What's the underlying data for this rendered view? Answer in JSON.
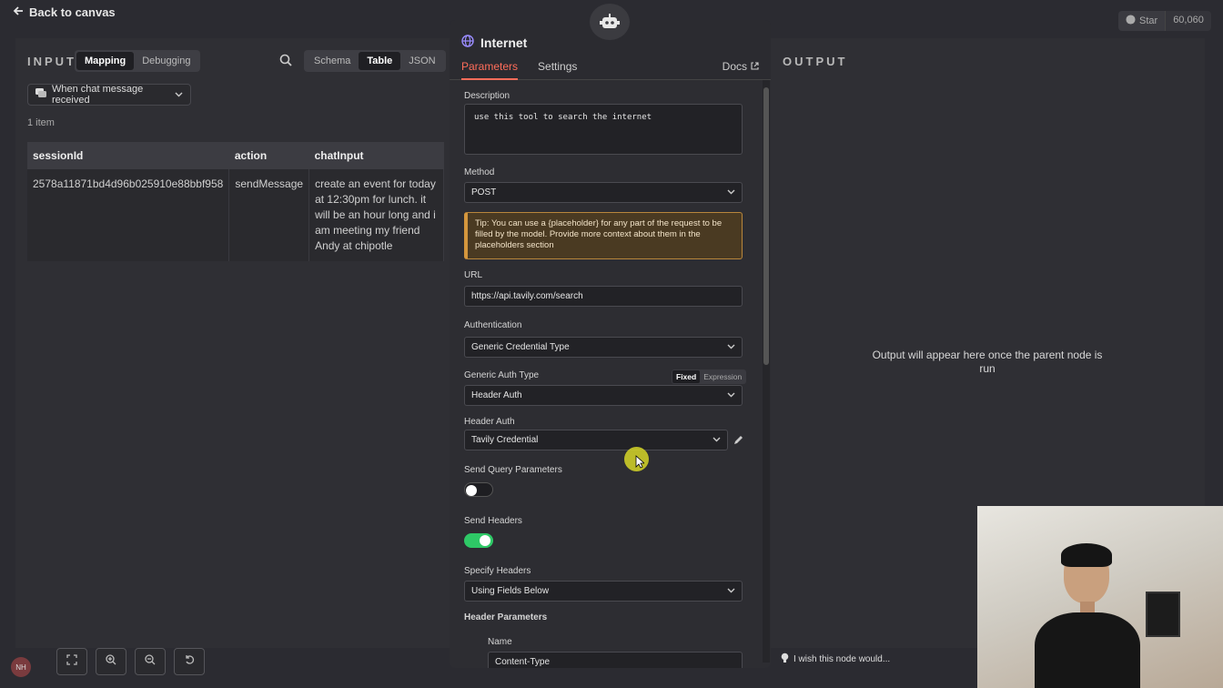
{
  "canvas": {
    "back_label": "Back to canvas",
    "star_label": "Star",
    "star_count": "60,060"
  },
  "input": {
    "title": "INPUT",
    "mode_tabs": [
      "Mapping",
      "Debugging"
    ],
    "view_tabs": [
      "Schema",
      "Table",
      "JSON"
    ],
    "trigger_label": "When chat message received",
    "items_count": "1 item",
    "columns": [
      "sessionId",
      "action",
      "chatInput"
    ],
    "row": {
      "sessionId": "2578a11871bd4d96b025910e88bbf958",
      "action": "sendMessage",
      "chatInput_lines": [
        " create an event for today",
        "at 12:30pm for lunch. it",
        "will be an hour long and i",
        "am meeting my friend",
        "Andy at chipotle"
      ]
    }
  },
  "node": {
    "title": "Internet",
    "tabs": [
      "Parameters",
      "Settings"
    ],
    "docs_label": "Docs",
    "description_label": "Description",
    "description_value": "use this tool to search the internet",
    "method_label": "Method",
    "method_value": "POST",
    "tip_text": "Tip: You can use a {placeholder} for any part of the request to be filled by the model. Provide more context about them in the placeholders section",
    "url_label": "URL",
    "url_value": "https://api.tavily.com/search",
    "auth_label": "Authentication",
    "auth_value": "Generic Credential Type",
    "generic_auth_label": "Generic Auth Type",
    "fixed_label": "Fixed",
    "expression_label": "Expression",
    "generic_auth_value": "Header Auth",
    "header_auth_label": "Header Auth",
    "header_auth_value": "Tavily Credential",
    "send_query_label": "Send Query Parameters",
    "send_query_on": false,
    "send_headers_label": "Send Headers",
    "send_headers_on": true,
    "specify_headers_label": "Specify Headers",
    "specify_headers_value": "Using Fields Below",
    "header_params_label": "Header Parameters",
    "name_label": "Name",
    "name_value": "Content-Type"
  },
  "output": {
    "title": "OUTPUT",
    "empty_message": "Output will appear here once the parent node is run",
    "wish_label": "I wish this node would..."
  },
  "user": {
    "avatar_initials": "NH"
  },
  "colors": {
    "accent": "#ff6d5a",
    "toggle_on": "#2ec866",
    "tip_border": "#d4963d"
  }
}
